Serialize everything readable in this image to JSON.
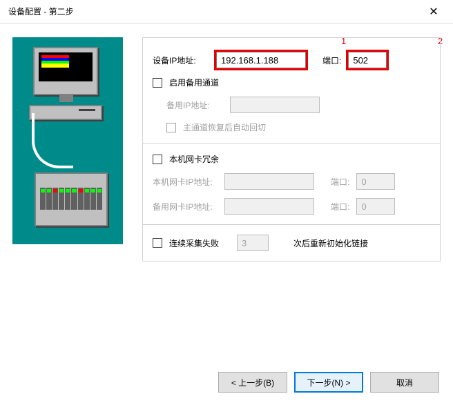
{
  "window": {
    "title": "设备配置 - 第二步"
  },
  "annotations": {
    "one": "1",
    "two": "2"
  },
  "form": {
    "ip_label": "设备IP地址:",
    "ip_value": "192.168.1.188",
    "port_label": "端口:",
    "port_value": "502",
    "backup": {
      "enable_label": "启用备用通道",
      "ip_label": "备用IP地址:",
      "ip_value": "",
      "auto_switch_label": "主通道恢复后自动回切"
    },
    "nic": {
      "enable_label": "本机网卡冗余",
      "primary_label": "本机网卡IP地址:",
      "primary_value": "",
      "primary_port_label": "端口:",
      "primary_port_value": "0",
      "backup_label": "备用网卡IP地址:",
      "backup_value": "",
      "backup_port_label": "端口:",
      "backup_port_value": "0"
    },
    "retry": {
      "label": "连续采集失败",
      "count": "3",
      "tail": "次后重新初始化链接"
    }
  },
  "buttons": {
    "back": "< 上一步(B)",
    "next": "下一步(N) >",
    "cancel": "取消"
  }
}
